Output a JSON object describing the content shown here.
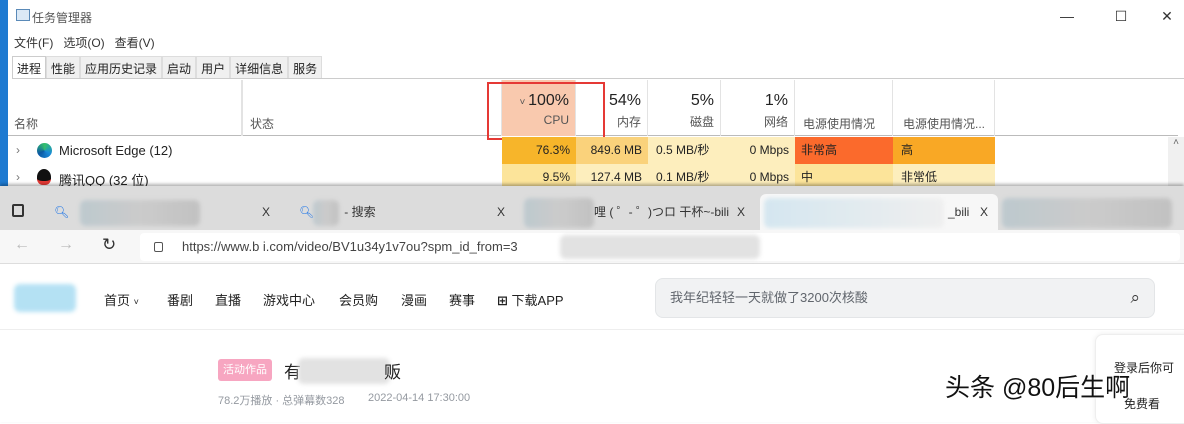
{
  "taskmgr": {
    "title": "任务管理器",
    "menu": [
      "文件(F)",
      "选项(O)",
      "查看(V)"
    ],
    "tabs": [
      "进程",
      "性能",
      "应用历史记录",
      "启动",
      "用户",
      "详细信息",
      "服务"
    ],
    "columns": {
      "name": "名称",
      "status": "状态",
      "cpu_pct": "100%",
      "cpu": "CPU",
      "mem_pct": "54%",
      "mem": "内存",
      "disk_pct": "5%",
      "disk": "磁盘",
      "net_pct": "1%",
      "net": "网络",
      "power": "电源使用情况",
      "power_trend": "电源使用情况..."
    },
    "rows": [
      {
        "name": "Microsoft Edge (12)",
        "cpu": "76.3%",
        "mem": "849.6 MB",
        "disk": "0.5 MB/秒",
        "net": "0 Mbps",
        "power": "非常高",
        "trend": "高"
      },
      {
        "name": "腾讯QQ (32 位)",
        "cpu": "9.5%",
        "mem": "127.4 MB",
        "disk": "0.1 MB/秒",
        "net": "0 Mbps",
        "power": "中",
        "trend": "非常低"
      }
    ],
    "controls": {
      "min": "—",
      "max": "☐",
      "close": "✕"
    }
  },
  "browser": {
    "tabs": [
      {
        "title": ""
      },
      {
        "title": "- 搜索"
      },
      {
        "title": "哩 ( ゜- ゜)つロ 干杯~-bili"
      },
      {
        "title": "_bili"
      },
      {
        "title": ""
      }
    ],
    "close": "X",
    "url": "https://www.b   i.com/video/BV1u34y1v7ou?spm_id_from=3",
    "nav": [
      "首页",
      "番剧",
      "直播",
      "游戏中心",
      "会员购",
      "漫画",
      "赛事",
      "下载APP"
    ],
    "search_placeholder": "我年纪轻轻一天就做了3200次核酸",
    "video": {
      "badge": "活动作品",
      "title_start": "有",
      "title_end": "贩",
      "meta": "78.2万播放 · 总弹幕数328",
      "date": "2022-04-14 17:30:00"
    },
    "login_hint": "登录后你可",
    "login_hint2": "免费看"
  },
  "watermark": "头条 @80后生啊"
}
